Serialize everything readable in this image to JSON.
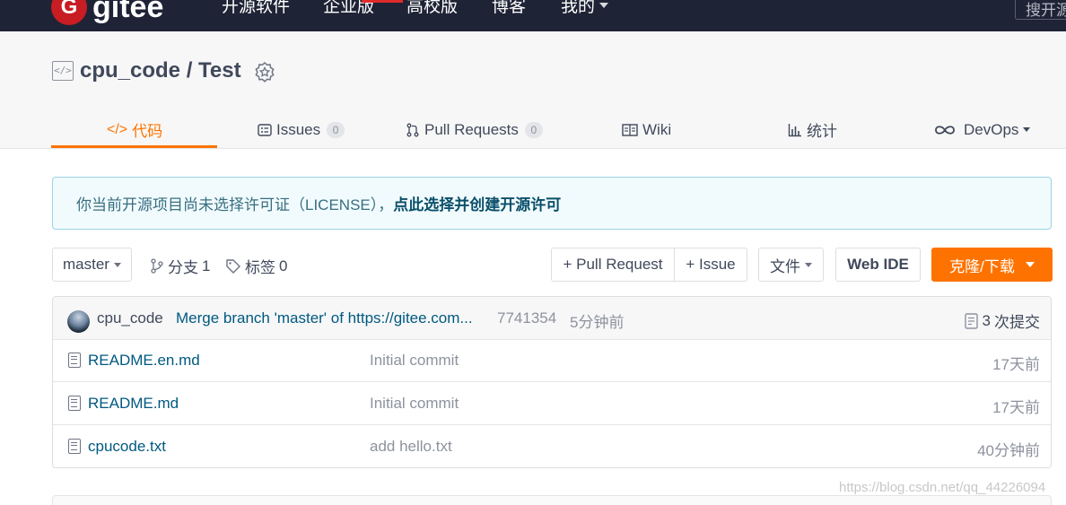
{
  "nav": {
    "logo_letter": "G",
    "logo_text": "gitee",
    "links": [
      "开源软件",
      "企业版",
      "高校版",
      "博客",
      "我的"
    ],
    "search_placeholder": "搜开源"
  },
  "repo": {
    "code_icon_glyph": "</>",
    "owner": "cpu_code",
    "separator": " / ",
    "name": "Test"
  },
  "tabs": [
    {
      "label": "代码",
      "icon": "code-icon",
      "active": true
    },
    {
      "label": "Issues",
      "count": "0",
      "icon": "issues-icon"
    },
    {
      "label": "Pull Requests",
      "count": "0",
      "icon": "pull-request-icon"
    },
    {
      "label": "Wiki",
      "icon": "wiki-icon"
    },
    {
      "label": "统计",
      "icon": "stats-icon"
    },
    {
      "label": "DevOps",
      "icon": "devops-icon"
    }
  ],
  "notice": {
    "text": "你当前开源项目尚未选择许可证（LICENSE），",
    "link": "点此选择并创建开源许可"
  },
  "toolbar": {
    "branch": "master",
    "branches_label": "分支",
    "branches_count": "1",
    "tags_label": "标签",
    "tags_count": "0",
    "pull_request": "+ Pull Request",
    "issue": "+ Issue",
    "file_menu": "文件",
    "web_ide": "Web IDE",
    "clone": "克隆/下载"
  },
  "latest_commit": {
    "author": "cpu_code",
    "message": "Merge branch 'master' of https://gitee.com...",
    "sha": "7741354",
    "time": "5分钟前",
    "commits_count": "3",
    "commits_label": "次提交"
  },
  "files": [
    {
      "name": "README.en.md",
      "message": "Initial commit",
      "time": "17天前"
    },
    {
      "name": "README.md",
      "message": "Initial commit",
      "time": "17天前"
    },
    {
      "name": "cpucode.txt",
      "message": "add hello.txt",
      "time": "40分钟前"
    }
  ],
  "watermark": "https://blog.csdn.net/qq_44226094",
  "colors": {
    "accent": "#fe7300",
    "nav_bg": "#1f2336",
    "link": "#005980",
    "brand_red": "#c71d23"
  }
}
